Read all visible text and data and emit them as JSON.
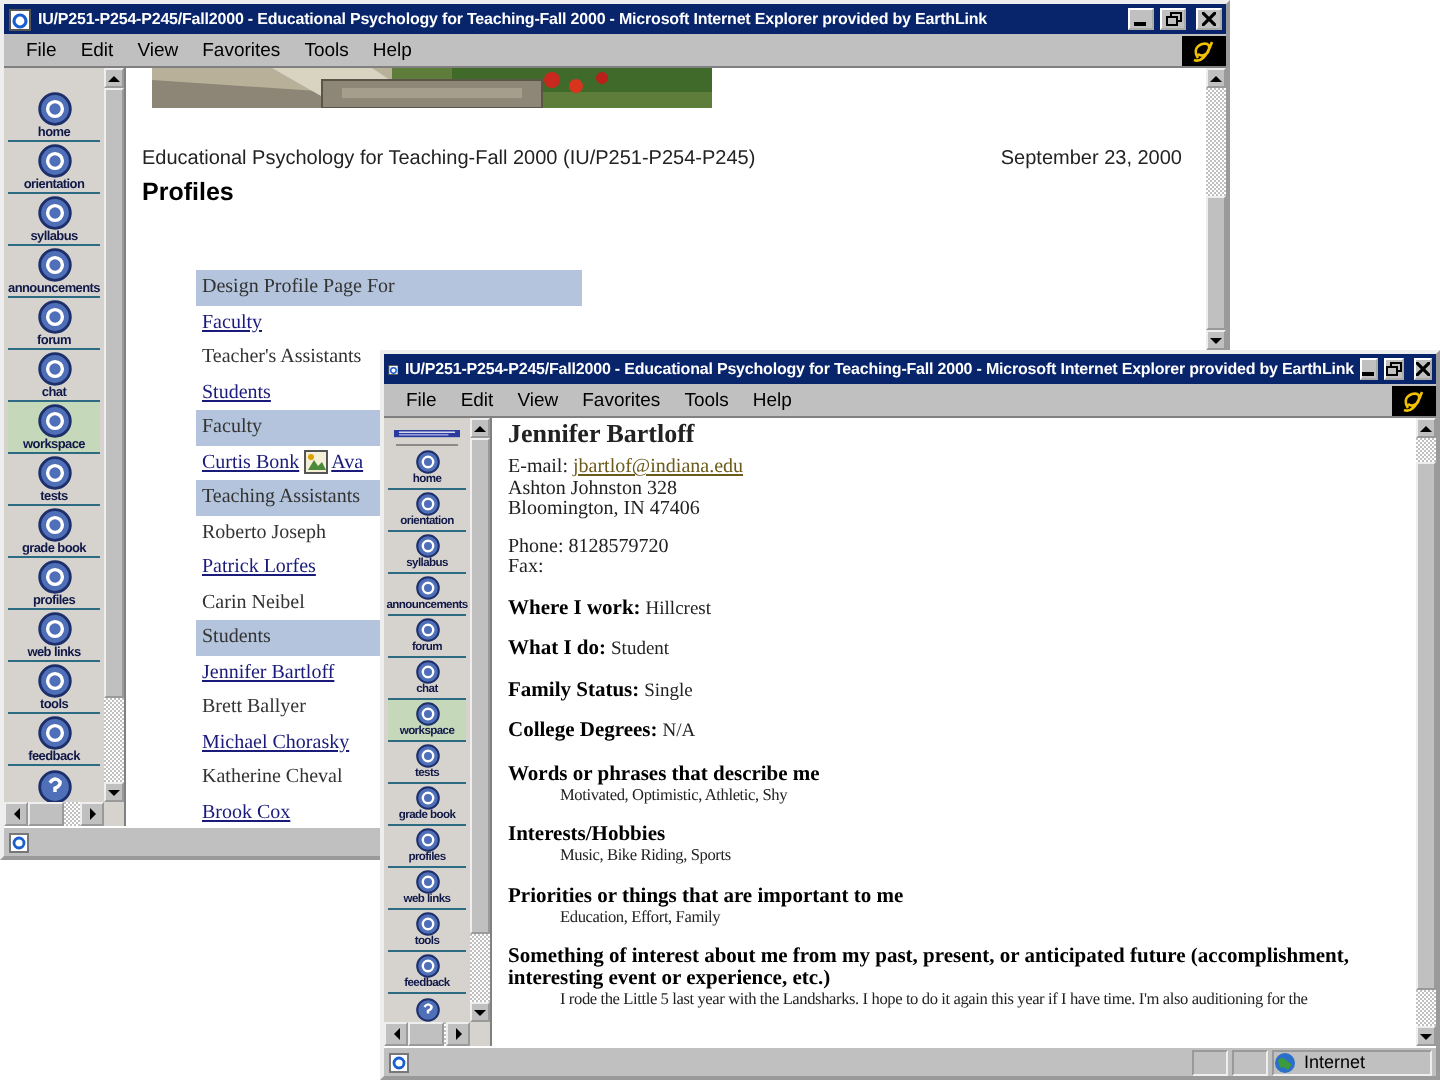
{
  "back_window": {
    "title": "IU/P251-P254-P245/Fall2000 - Educational Psychology for Teaching-Fall 2000 - Microsoft Internet Explorer provided by EarthLink",
    "menu": [
      "File",
      "Edit",
      "View",
      "Favorites",
      "Tools",
      "Help"
    ],
    "sidebar": [
      {
        "label": "home",
        "selected": false
      },
      {
        "label": "orientation",
        "selected": false
      },
      {
        "label": "syllabus",
        "selected": false
      },
      {
        "label": "announcements",
        "selected": false
      },
      {
        "label": "forum",
        "selected": false
      },
      {
        "label": "chat",
        "selected": false
      },
      {
        "label": "workspace",
        "selected": true
      },
      {
        "label": "tests",
        "selected": false
      },
      {
        "label": "grade book",
        "selected": false
      },
      {
        "label": "profiles",
        "selected": false
      },
      {
        "label": "web links",
        "selected": false
      },
      {
        "label": "tools",
        "selected": false
      },
      {
        "label": "feedback",
        "selected": false
      }
    ],
    "course": "Educational Psychology for Teaching-Fall 2000 (IU/P251-P254-P245)",
    "date": "September 23, 2000",
    "heading": "Profiles",
    "rows": [
      {
        "kind": "header",
        "text": "Design Profile Page For"
      },
      {
        "kind": "link",
        "text": "Faculty"
      },
      {
        "kind": "plain",
        "text": "Teacher's Assistants"
      },
      {
        "kind": "link",
        "text": "Students"
      },
      {
        "kind": "header",
        "text": "Faculty"
      },
      {
        "kind": "link_icon",
        "text": "Curtis Bonk",
        "second": "Ava"
      },
      {
        "kind": "header",
        "text": "Teaching Assistants"
      },
      {
        "kind": "plain",
        "text": "Roberto Joseph"
      },
      {
        "kind": "link",
        "text": "Patrick Lorfes"
      },
      {
        "kind": "plain",
        "text": "Carin Neibel"
      },
      {
        "kind": "header",
        "text": "Students"
      },
      {
        "kind": "link",
        "text": "Jennifer Bartloff"
      },
      {
        "kind": "plain",
        "text": "Brett Ballyer"
      },
      {
        "kind": "link",
        "text": "Michael Chorasky"
      },
      {
        "kind": "plain",
        "text": "Katherine Cheval"
      },
      {
        "kind": "link",
        "text": "Brook Cox"
      }
    ]
  },
  "front_window": {
    "title": "IU/P251-P254-P245/Fall2000 - Educational Psychology for Teaching-Fall 2000 - Microsoft Internet Explorer provided by EarthLink",
    "menu": [
      "File",
      "Edit",
      "View",
      "Favorites",
      "Tools",
      "Help"
    ],
    "sidebar": [
      {
        "label": "home",
        "selected": false
      },
      {
        "label": "orientation",
        "selected": false
      },
      {
        "label": "syllabus",
        "selected": false
      },
      {
        "label": "announcements",
        "selected": false
      },
      {
        "label": "forum",
        "selected": false
      },
      {
        "label": "chat",
        "selected": false
      },
      {
        "label": "workspace",
        "selected": true
      },
      {
        "label": "tests",
        "selected": false
      },
      {
        "label": "grade book",
        "selected": false
      },
      {
        "label": "profiles",
        "selected": false
      },
      {
        "label": "web links",
        "selected": false
      },
      {
        "label": "tools",
        "selected": false
      },
      {
        "label": "feedback",
        "selected": false
      }
    ],
    "name": "Jennifer Bartloff",
    "email_label": "E-mail:",
    "email": "jbartlof@indiana.edu",
    "address": [
      "Ashton Johnston 328",
      "Bloomington, IN 47406"
    ],
    "phone": "Phone: 8128579720",
    "fax": "Fax:",
    "sections": [
      {
        "kind": "inline",
        "label": "Where I work:",
        "value": "Hillcrest"
      },
      {
        "kind": "inline",
        "label": "What I do:",
        "value": "Student"
      },
      {
        "kind": "inline",
        "label": "Family Status:",
        "value": "Single"
      },
      {
        "kind": "inline",
        "label": "College Degrees:",
        "value": "N/A"
      },
      {
        "kind": "block",
        "label": "Words or phrases that describe me",
        "value": "Motivated, Optimistic, Athletic, Shy"
      },
      {
        "kind": "block",
        "label": "Interests/Hobbies",
        "value": "Music, Bike Riding, Sports"
      },
      {
        "kind": "block",
        "label": "Priorities or things that are important to me",
        "value": "Education, Effort, Family"
      },
      {
        "kind": "block",
        "label": "Something of interest about me from my past, present, or anticipated future (accomplishment, interesting event or experience, etc.)",
        "value": "I rode the Little 5 last year with the Landsharks. I hope to do it again this year if I have time. I'm also auditioning for the"
      }
    ],
    "status": "Internet"
  }
}
